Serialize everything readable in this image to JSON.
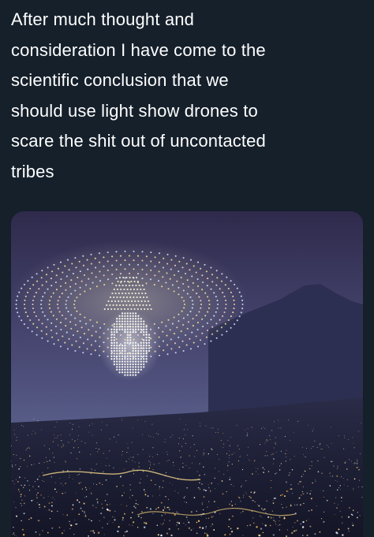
{
  "tweet": {
    "text": "After much thought and\nconsideration I have come to the\nscientific conclusion that we\nshould use light show drones to\nscare the shit out of uncontacted\ntribes"
  },
  "media": {
    "subject": "drone-light-show-skull-sombrero"
  },
  "colors": {
    "background": "#15202b",
    "text": "#ffffff",
    "sky_top": "#3a3158",
    "sky_bottom": "#5a5e86",
    "drone_light": "#f4e9b8"
  }
}
